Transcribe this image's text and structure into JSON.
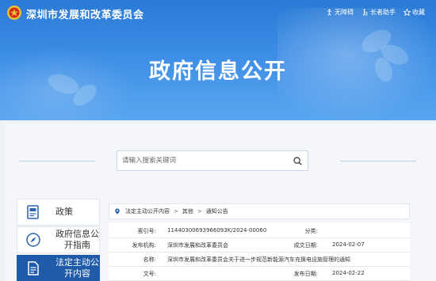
{
  "header": {
    "site_title": "深圳市发展和改革委员会",
    "tools": [
      {
        "label": "无障碍",
        "icon": "accessibility-icon"
      },
      {
        "label": "长者助手",
        "icon": "elder-assist-icon"
      },
      {
        "label": "收藏",
        "icon": "star-icon"
      }
    ],
    "page_heading": "政府信息公开"
  },
  "search": {
    "placeholder": "请输入搜索关键词",
    "icon": "search-icon"
  },
  "nav": {
    "items": [
      {
        "label": "政策",
        "icon": "book-icon",
        "active": false
      },
      {
        "label": "政府信息公开指南",
        "icon": "compass-icon",
        "active": false
      },
      {
        "label": "法定主动公开内容",
        "icon": "document-icon",
        "active": true
      }
    ]
  },
  "breadcrumb": {
    "icon": "location-pin-icon",
    "items": [
      "法定主动公开内容",
      "其他",
      "通知公告"
    ]
  },
  "info": {
    "index_label": "索引号:",
    "index_value": "11440300693966093K/2024-00060",
    "category_label": "分类:",
    "category_value": "",
    "publisher_label": "发布机构:",
    "publisher_value": "深圳市发展和改革委员会",
    "created_label": "成文日期:",
    "created_value": "2024-02-07",
    "name_label": "名称:",
    "name_value": "深圳市发展和改革委员会关于进一步规范新能源汽车充换电设施管理的通知",
    "doc_no_label": "文号:",
    "doc_no_value": "",
    "published_label": "发布日期:",
    "published_value": "2024-02-22"
  },
  "colors": {
    "banner": "#3c8de6",
    "nav_active": "#1f5ba8"
  }
}
